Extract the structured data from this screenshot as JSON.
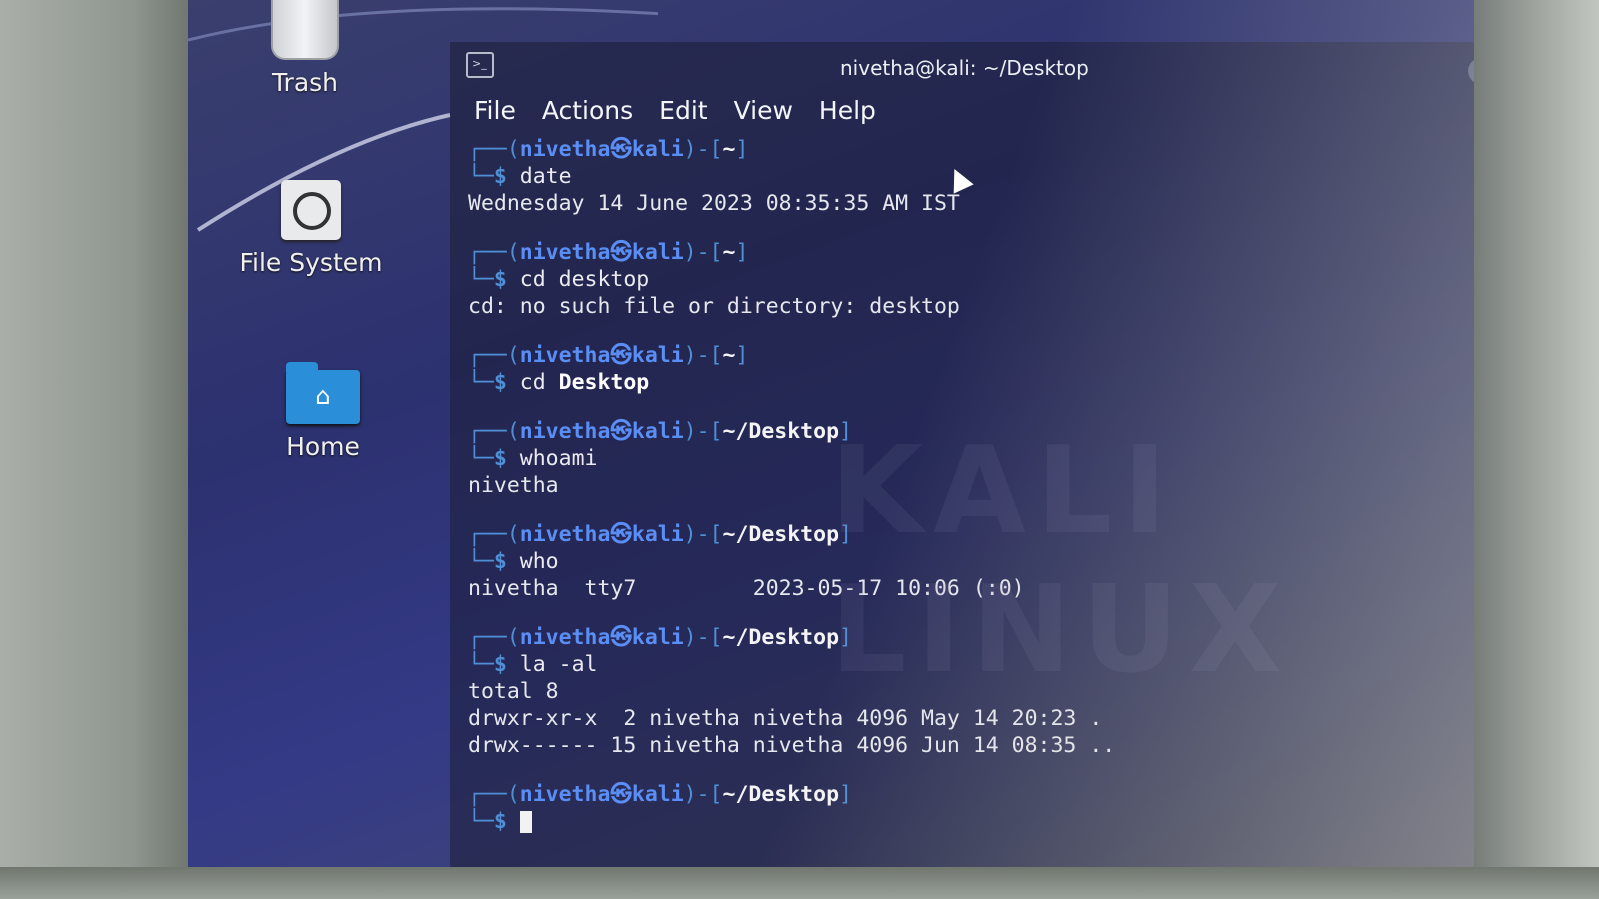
{
  "desktop": {
    "icons": [
      {
        "label": "Trash"
      },
      {
        "label": "File System"
      },
      {
        "label": "Home"
      }
    ]
  },
  "window": {
    "title": "nivetha@kali: ~/Desktop",
    "menu": [
      "File",
      "Actions",
      "Edit",
      "View",
      "Help"
    ]
  },
  "prompt": {
    "open": "┌──(",
    "user_host": "nivetha㉿kali",
    "mid": ")-[",
    "close": "]",
    "second": "└─",
    "dollar": "$"
  },
  "blocks": [
    {
      "path": "~",
      "cmd": "date",
      "output": [
        "Wednesday 14 June 2023 08:35:35 AM IST"
      ]
    },
    {
      "path": "~",
      "cmd": "cd desktop",
      "output": [
        "cd: no such file or directory: desktop"
      ]
    },
    {
      "path": "~",
      "cmd_pre": "cd ",
      "cmd_bold": "Desktop",
      "output": []
    },
    {
      "path": "~/Desktop",
      "cmd": "whoami",
      "output": [
        "nivetha"
      ]
    },
    {
      "path": "~/Desktop",
      "cmd": "who",
      "output": [
        "nivetha  tty7         2023-05-17 10:06 (:0)"
      ]
    },
    {
      "path": "~/Desktop",
      "cmd": "la -al",
      "output": [
        "total 8",
        "drwxr-xr-x  2 nivetha nivetha 4096 May 14 20:23 .",
        "drwx------ 15 nivetha nivetha 4096 Jun 14 08:35 .."
      ]
    },
    {
      "path": "~/Desktop",
      "cmd": "",
      "output": []
    }
  ],
  "watermark": "KALI LINUX"
}
